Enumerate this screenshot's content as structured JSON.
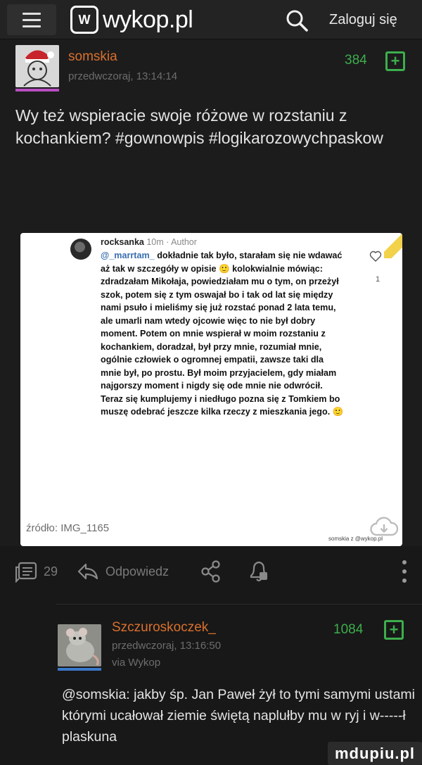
{
  "header": {
    "logo_mark": "W",
    "logo_text": "wykop.pl",
    "login_label": "Zaloguj się"
  },
  "post": {
    "author": "somskia",
    "timestamp": "przedwczoraj, 13:14:14",
    "votes": "384",
    "plus_label": "+",
    "text": "Wy też wspieracie swoje różowe w rozstaniu z kochankiem? #gownowpis #logikarozowychpaskow",
    "embed": {
      "username": "rocksanka",
      "meta": "10m · Author",
      "mention": "@_marrtam_",
      "body": "dokładnie tak było, starałam się nie wdawać aż tak w szczegóły w opisie 🙂 kolokwialnie mówiąc: zdradzałam Mikołaja, powiedziałam mu o tym, on przeżył szok, potem się z tym oswajał bo i tak od lat się między nami psuło i mieliśmy się już rozstać ponad 2 lata temu, ale umarli nam wtedy ojcowie więc to nie był dobry moment. Potem on mnie wspierał w moim rozstaniu z kochankiem, doradzał, był przy mnie, rozumiał mnie, ogólnie człowiek o ogromnej empatii, zawsze taki dla mnie był, po prostu. Był moim przyjacielem, gdy miałam najgorszy moment i nigdy się ode mnie nie odwrócił. Teraz się kumplujemy i niedługo pozna się z Tomkiem bo muszę odebrać jeszcze kilka rzeczy z mieszkania jego. 🙂",
      "like_count": "1",
      "footer": "somskia z @wykop.pl"
    },
    "source": "źródło: IMG_1165",
    "comments_count": "29",
    "reply_label": "Odpowiedz"
  },
  "reply": {
    "author": "Szczuroskoczek_",
    "timestamp": "przedwczoraj, 13:16:50",
    "via": "via Wykop",
    "votes": "1084",
    "plus_label": "+",
    "text": "@somskia: jakby śp. Jan Paweł żył to tymi samymi ustami którymi ucałował ziemie świętą naplułby mu w ryj i w-----ł plaskuna"
  },
  "watermark": "mdupiu.pl",
  "colors": {
    "background": "#181818",
    "author": "#d9702d",
    "votes": "#3dae4c",
    "muted": "#6d6d6d",
    "female_bar": "#b84ec1",
    "male_bar": "#3a78c9"
  },
  "icons": [
    "menu-icon",
    "search-icon",
    "cloud-download-icon",
    "comment-icon",
    "reply-icon",
    "share-icon",
    "bell-icon",
    "more-icon",
    "heart-icon"
  ]
}
